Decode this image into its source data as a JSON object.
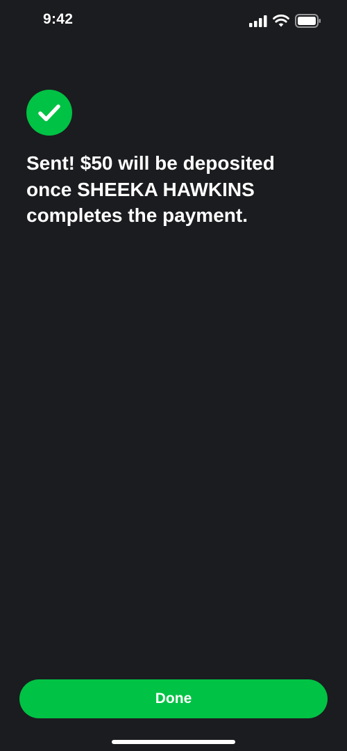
{
  "status_bar": {
    "time": "9:42",
    "icons": [
      "signal-icon",
      "wifi-icon",
      "battery-icon"
    ]
  },
  "confirmation": {
    "icon": "checkmark-icon",
    "message_lines": [
      "Sent! $50 will be deposited",
      "once SHEEKA HAWKINS",
      "completes the payment."
    ]
  },
  "actions": {
    "done_label": "Done"
  },
  "colors": {
    "background": "#1b1c1f",
    "accent": "#00c244",
    "text": "#ffffff"
  }
}
